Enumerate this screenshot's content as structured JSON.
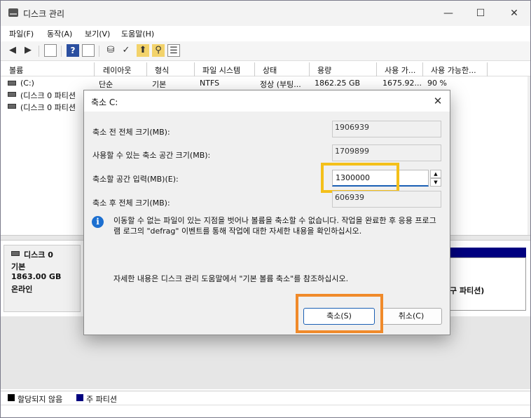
{
  "window": {
    "title": "디스크 관리",
    "minimize": "—",
    "maximize": "☐",
    "close": "✕"
  },
  "menu": [
    "파일(F)",
    "동작(A)",
    "보기(V)",
    "도움말(H)"
  ],
  "columns": [
    "볼륨",
    "레이아웃",
    "형식",
    "파일 시스템",
    "상태",
    "용량",
    "사용 가...",
    "사용 가능한..."
  ],
  "volumes": [
    {
      "name": "(C:)",
      "layout": "단순",
      "type": "기본",
      "fs": "NTFS",
      "status": "정상 (부팅...",
      "capacity": "1862.25 GB",
      "free": "1675.92...",
      "pct": "90 %"
    },
    {
      "name": "(디스크 0 파티션",
      "layout": "",
      "type": "",
      "fs": "",
      "status": "",
      "capacity": "",
      "free": "",
      "pct": ""
    },
    {
      "name": "(디스크 0 파티션",
      "layout": "",
      "type": "",
      "fs": "",
      "status": "",
      "capacity": "",
      "free": "",
      "pct": ""
    }
  ],
  "disk": {
    "name": "디스크 0",
    "type": "기본",
    "size": "1863.00 GB",
    "state": "온라인",
    "partition_label": "구 파티션)"
  },
  "legend": {
    "unallocated": "할당되지 않음",
    "primary": "주 파티션"
  },
  "dialog": {
    "title": "축소 C:",
    "total_before_label": "축소 전 전체 크기(MB):",
    "total_before_value": "1906939",
    "available_label": "사용할 수 있는 축소 공간 크기(MB):",
    "available_value": "1709899",
    "shrink_label": "축소할 공간 입력(MB)(E):",
    "shrink_value": "1300000",
    "total_after_label": "축소 후 전체 크기(MB):",
    "total_after_value": "606939",
    "info": "이동할 수 없는 파일이 있는 지점을 벗어나 볼륨을 축소할 수 없습니다. 작업을 완료한 후 응용 프로그램 로그의 \"defrag\" 이벤트를 통해 작업에 대한 자세한 내용을 확인하십시오.",
    "help": "자세한 내용은 디스크 관리 도움말에서 \"기본 볼륨 축소\"를 참조하십시오.",
    "shrink_button": "축소(S)",
    "cancel_button": "취소(C)"
  }
}
